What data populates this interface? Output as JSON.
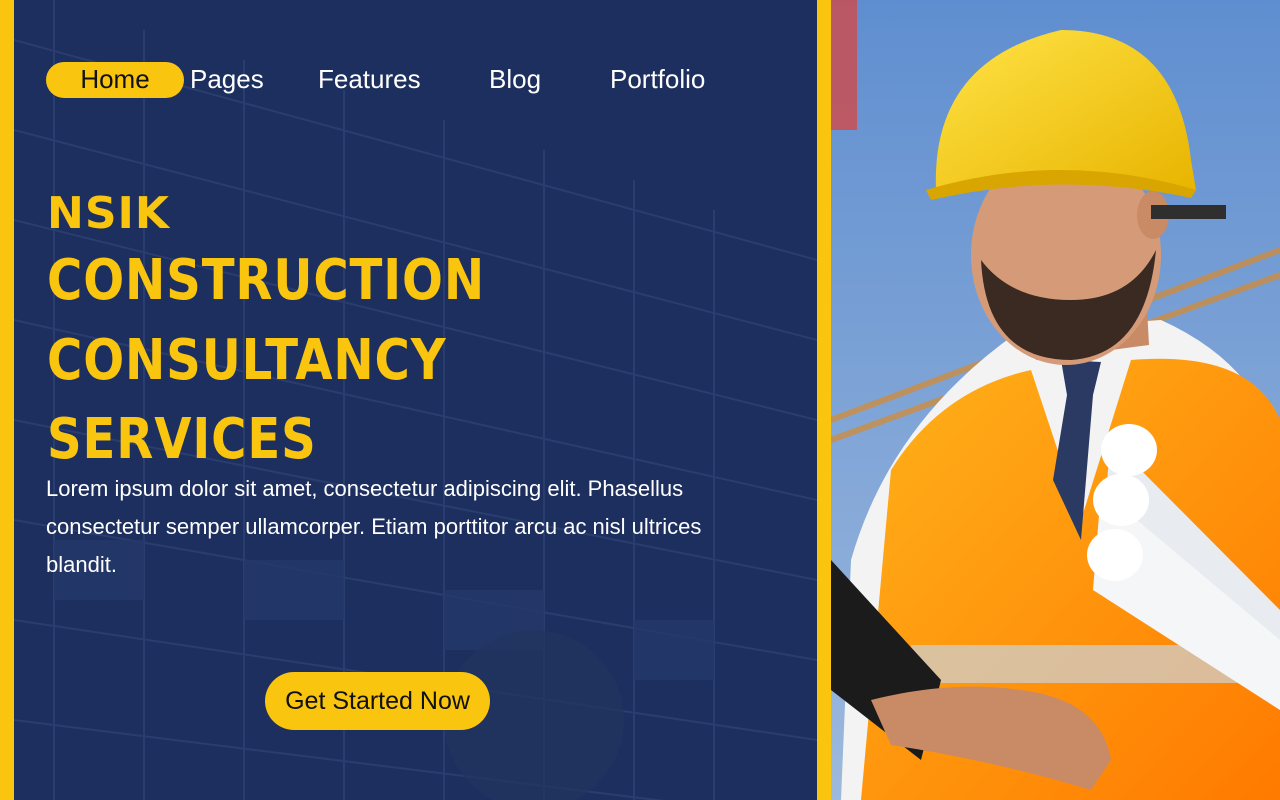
{
  "nav": {
    "items": [
      {
        "label": "Home",
        "active": true
      },
      {
        "label": "Pages"
      },
      {
        "label": "Features"
      },
      {
        "label": "Blog"
      },
      {
        "label": "Portfolio"
      }
    ]
  },
  "hero": {
    "brand": "NSIK",
    "headline_lines": [
      "CONSTRUCTION",
      "CONSULTANCY",
      "SERVICES"
    ],
    "description": "Lorem ipsum dolor sit amet, consectetur adipiscing elit. Phasellus consectetur semper ullamcorper. Etiam porttitor arcu ac nisl ultrices blandit.",
    "cta_label": "Get Started Now"
  },
  "photo": {
    "subject": "construction-engineer-in-hard-hat"
  },
  "colors": {
    "accent": "#f9c50f",
    "panel": "#1d2f5e",
    "text_light": "#ffffff",
    "text_dark": "#111111"
  }
}
